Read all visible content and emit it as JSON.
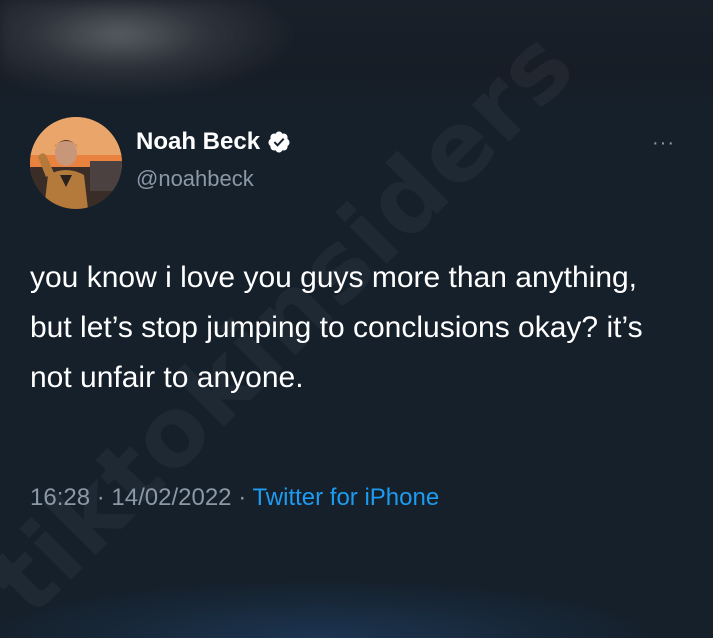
{
  "user": {
    "display_name": "Noah Beck",
    "handle": "@noahbeck",
    "verified": true
  },
  "tweet": {
    "text": "you know i love you guys more than anything, but let’s stop jumping to conclusions okay? it’s not unfair to anyone.",
    "time": "16:28",
    "date": "14/02/2022",
    "source": "Twitter for iPhone",
    "separator": "·"
  },
  "menu": {
    "more_glyph": "···"
  },
  "watermark": {
    "text": "tiktokinsiders"
  },
  "colors": {
    "background": "#15202b",
    "text_primary": "#ffffff",
    "text_secondary": "#8b98a5",
    "link": "#1d9bf0"
  }
}
